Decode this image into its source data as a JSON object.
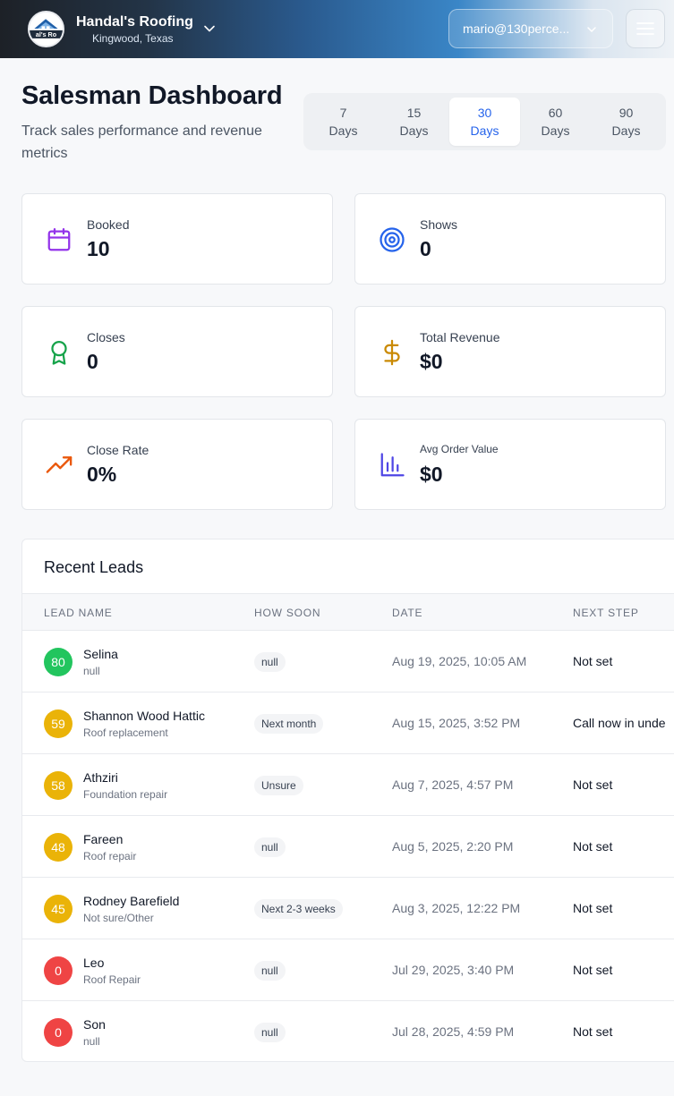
{
  "header": {
    "brand_name": "Handal's Roofing",
    "brand_location": "Kingwood, Texas",
    "logo_text": "al's Ro",
    "user_email": "mario@130perce...",
    "colors": {
      "accent": "#2563eb"
    }
  },
  "page": {
    "title": "Salesman Dashboard",
    "subtitle": "Track sales performance and revenue metrics"
  },
  "range": {
    "options": [
      {
        "num": "7",
        "unit": "Days"
      },
      {
        "num": "15",
        "unit": "Days"
      },
      {
        "num": "30",
        "unit": "Days"
      },
      {
        "num": "60",
        "unit": "Days"
      },
      {
        "num": "90",
        "unit": "Days"
      }
    ],
    "selected": "30"
  },
  "stats": [
    {
      "label": "Booked",
      "value": "10",
      "icon": "calendar-icon",
      "color": "#9333ea"
    },
    {
      "label": "Shows",
      "value": "0",
      "icon": "target-icon",
      "color": "#2563eb"
    },
    {
      "label": "Closes",
      "value": "0",
      "icon": "award-icon",
      "color": "#16a34a"
    },
    {
      "label": "Total Revenue",
      "value": "$0",
      "icon": "dollar-icon",
      "color": "#ca8a04"
    },
    {
      "label": "Close Rate",
      "value": "0%",
      "icon": "trending-up-icon",
      "color": "#ea580c"
    },
    {
      "label": "Avg Order Value",
      "value": "$0",
      "icon": "bar-chart-icon",
      "color": "#4f46e5"
    }
  ],
  "leads": {
    "title": "Recent Leads",
    "columns": [
      "LEAD NAME",
      "HOW SOON",
      "DATE",
      "NEXT STEP"
    ],
    "rows": [
      {
        "score": "80",
        "score_color": "#22c55e",
        "name": "Selina",
        "service": "null",
        "how_soon": "null",
        "date": "Aug 19, 2025, 10:05 AM",
        "next_step": "Not set"
      },
      {
        "score": "59",
        "score_color": "#eab308",
        "name": "Shannon Wood Hattic",
        "service": "Roof replacement",
        "how_soon": "Next month",
        "date": "Aug 15, 2025, 3:52 PM",
        "next_step": "Call now in unde"
      },
      {
        "score": "58",
        "score_color": "#eab308",
        "name": "Athziri",
        "service": "Foundation repair",
        "how_soon": "Unsure",
        "date": "Aug 7, 2025, 4:57 PM",
        "next_step": "Not set"
      },
      {
        "score": "48",
        "score_color": "#eab308",
        "name": "Fareen",
        "service": "Roof repair",
        "how_soon": "null",
        "date": "Aug 5, 2025, 2:20 PM",
        "next_step": "Not set"
      },
      {
        "score": "45",
        "score_color": "#eab308",
        "name": "Rodney Barefield",
        "service": "Not sure/Other",
        "how_soon": "Next 2-3 weeks",
        "date": "Aug 3, 2025, 12:22 PM",
        "next_step": "Not set"
      },
      {
        "score": "0",
        "score_color": "#ef4444",
        "name": "Leo",
        "service": "Roof Repair",
        "how_soon": "null",
        "date": "Jul 29, 2025, 3:40 PM",
        "next_step": "Not set"
      },
      {
        "score": "0",
        "score_color": "#ef4444",
        "name": "Son",
        "service": "null",
        "how_soon": "null",
        "date": "Jul 28, 2025, 4:59 PM",
        "next_step": "Not set"
      }
    ]
  }
}
